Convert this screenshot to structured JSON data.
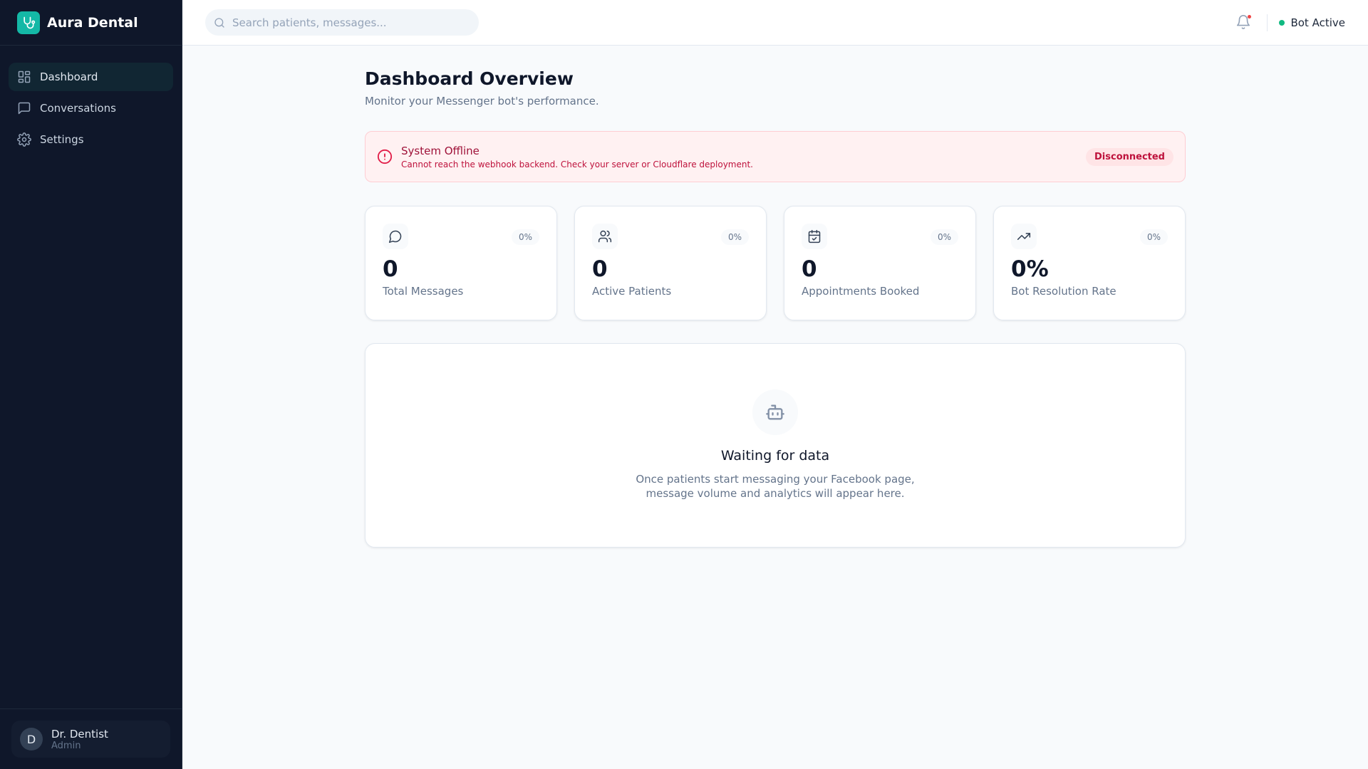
{
  "app": {
    "name": "Aura Dental"
  },
  "sidebar": {
    "items": [
      {
        "label": "Dashboard",
        "icon": "layout-dashboard-icon"
      },
      {
        "label": "Conversations",
        "icon": "message-square-icon"
      },
      {
        "label": "Settings",
        "icon": "gear-icon"
      }
    ],
    "user": {
      "initial": "D",
      "name": "Dr. Dentist",
      "role": "Admin"
    }
  },
  "header": {
    "search_placeholder": "Search patients, messages...",
    "status": "Bot Active",
    "status_color": "#10b981"
  },
  "page": {
    "title": "Dashboard Overview",
    "subtitle": "Monitor your Messenger bot's performance."
  },
  "alert": {
    "title": "System Offline",
    "description": "Cannot reach the webhook backend. Check your server or Cloudflare deployment.",
    "badge": "Disconnected"
  },
  "stats": [
    {
      "value": "0",
      "label": "Total Messages",
      "change": "0%"
    },
    {
      "value": "0",
      "label": "Active Patients",
      "change": "0%"
    },
    {
      "value": "0",
      "label": "Appointments Booked",
      "change": "0%"
    },
    {
      "value": "0%",
      "label": "Bot Resolution Rate",
      "change": "0%"
    }
  ],
  "empty": {
    "title": "Waiting for data",
    "line1": "Once patients start messaging your Facebook page,",
    "line2": "message volume and analytics will appear here."
  }
}
